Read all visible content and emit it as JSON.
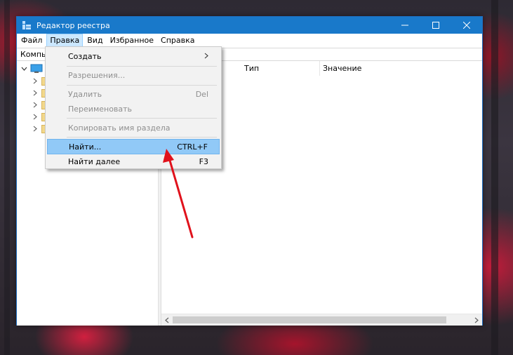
{
  "window": {
    "title": "Редактор реестра",
    "titlebar_color": "#1979ca"
  },
  "menubar": {
    "items": [
      "Файл",
      "Правка",
      "Вид",
      "Избранное",
      "Справка"
    ],
    "active_item": "Правка"
  },
  "addressbar": {
    "text": "Компь"
  },
  "list": {
    "columns": [
      "Тип",
      "Значение"
    ]
  },
  "edit_menu": {
    "items": [
      {
        "label": "Создать",
        "shortcut": "",
        "submenu": true,
        "enabled": true
      },
      {
        "label": "Разрешения...",
        "shortcut": "",
        "enabled": false
      },
      {
        "label": "Удалить",
        "shortcut": "Del",
        "enabled": false
      },
      {
        "label": "Переименовать",
        "shortcut": "",
        "enabled": false
      },
      {
        "label": "Копировать имя раздела",
        "shortcut": "",
        "enabled": false
      },
      {
        "label": "Найти...",
        "shortcut": "CTRL+F",
        "enabled": true,
        "highlighted": true
      },
      {
        "label": "Найти далее",
        "shortcut": "F3",
        "enabled": true
      }
    ],
    "highlight_color": "#91c9f7"
  },
  "annotation": {
    "arrow_color": "#e0121c"
  },
  "icons": {
    "app": "regedit-icon",
    "minimize": "minimize-icon",
    "maximize": "maximize-icon",
    "close": "close-icon",
    "computer": "computer-icon",
    "folder": "folder-icon",
    "expand": "chevron-right-icon",
    "collapse": "chevron-down-icon",
    "submenu": "chevron-right-icon"
  }
}
